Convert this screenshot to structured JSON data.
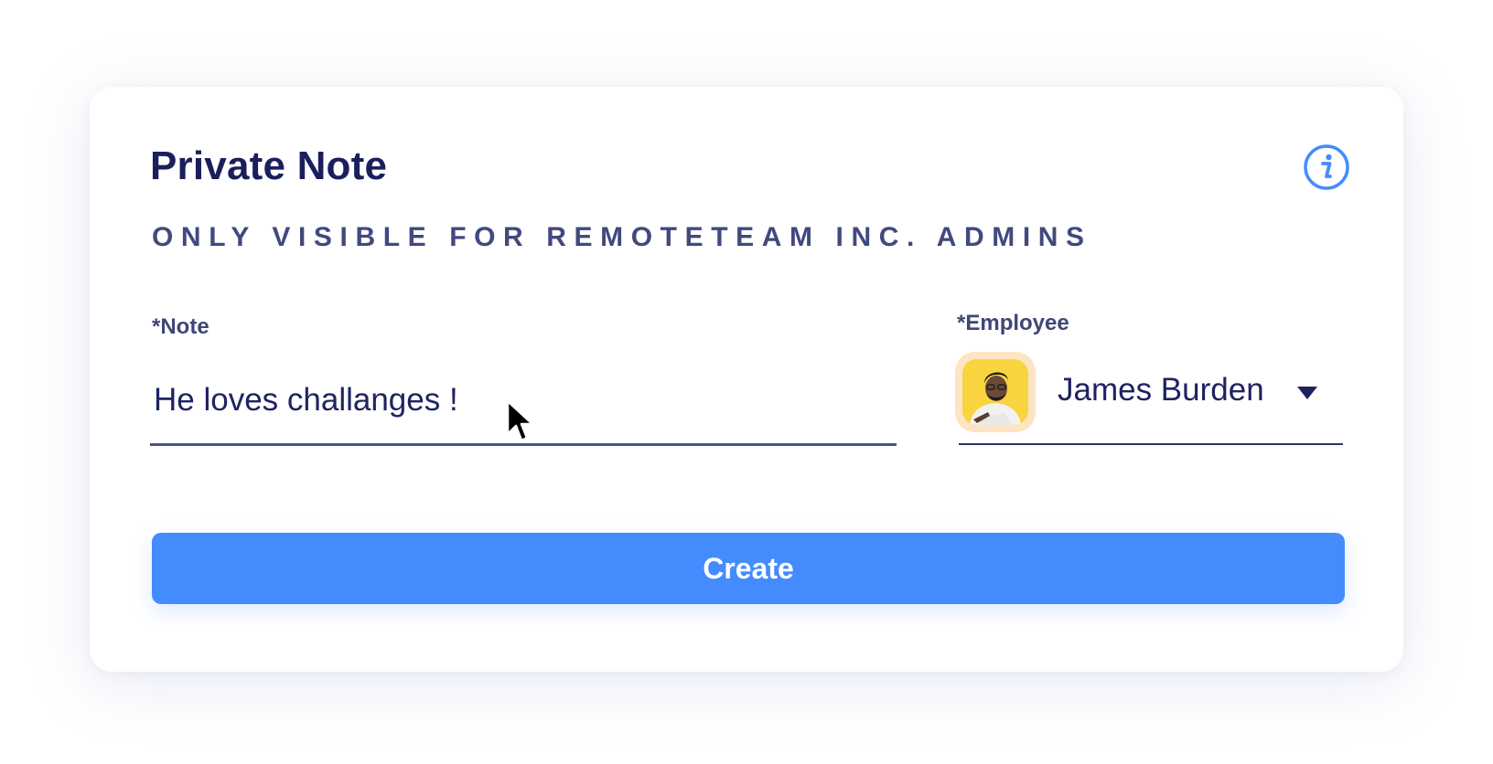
{
  "card": {
    "title": "Private Note",
    "subtitle": "ONLY VISIBLE FOR REMOTETEAM INC. ADMINS",
    "info_icon": "info-icon"
  },
  "note": {
    "label": "*Note",
    "value": "He loves challanges !"
  },
  "employee": {
    "label": "*Employee",
    "selected_name": "James Burden",
    "avatar_icon": "avatar",
    "caret_icon": "chevron-down-icon"
  },
  "actions": {
    "create_label": "Create"
  },
  "colors": {
    "title": "#1a1f5c",
    "subtitle": "#41497e",
    "primary_button": "#448cfd",
    "info_icon": "#448cfd",
    "avatar_bg": "#f8d43f",
    "avatar_ring": "#fde4c4"
  }
}
